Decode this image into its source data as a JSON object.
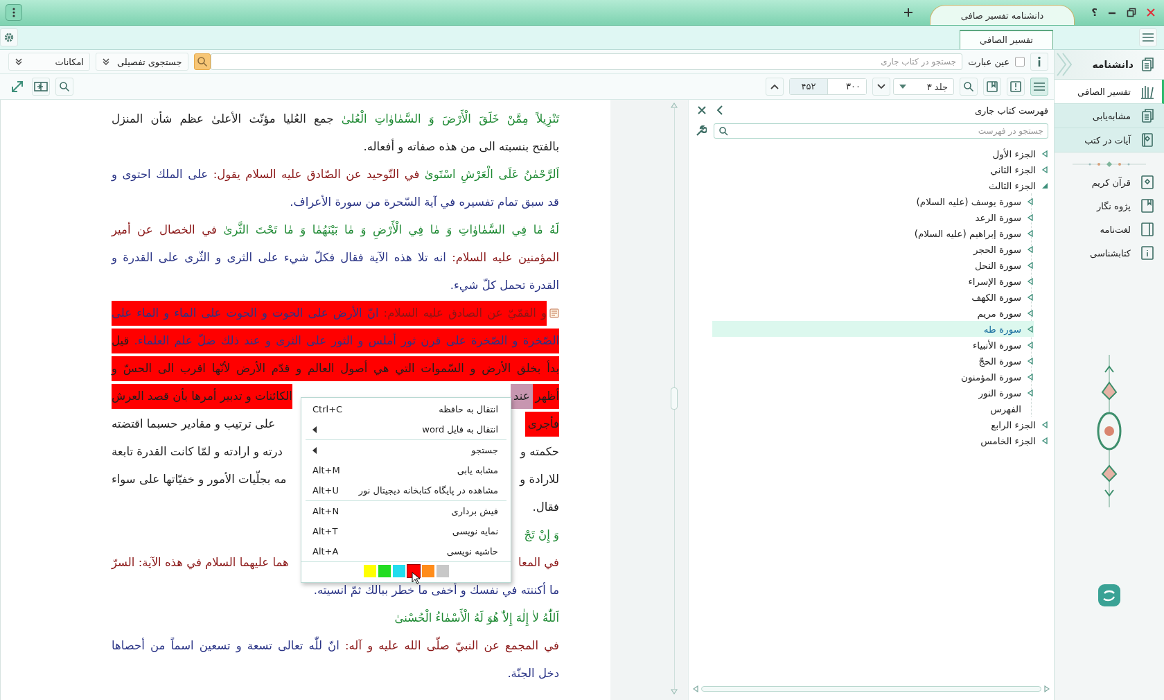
{
  "title_bar": {
    "tab_title": "دانشنامه تفسیر صافی",
    "help": "؟"
  },
  "document_tabs": [
    {
      "label": "تفسير الصافي",
      "selected": true
    }
  ],
  "search_bar": {
    "placeholder": "جستجو در کتاب جاری",
    "exact_phrase": {
      "label": "عین عبارت",
      "checked": false
    },
    "advanced_search": "جستجوی تفصیلی",
    "options": "امکانات"
  },
  "view_buttons": [
    {
      "kind": "list",
      "selected": true
    },
    {
      "kind": "book-alert",
      "selected": false
    },
    {
      "kind": "book",
      "selected": false
    },
    {
      "kind": "search",
      "selected": false
    }
  ],
  "page_nav": {
    "volume": "جلد ۳",
    "field_1": "۳۰۰",
    "field_2": "۴۵۲"
  },
  "text": {
    "lines": [
      {
        "last": false,
        "has_note": false,
        "fragments": [
          {
            "kind": "full",
            "highlighted": false,
            "selected": false,
            "runs": [
              {
                "kind": "quran",
                "text": "تَنْزِيلاً مِمَّنْ خَلَقَ الْأَرْضَ وَ السَّمٰاوٰاتِ الْعُلىٰ"
              },
              {
                "kind": "plain",
                "text": " جمع العُليا مؤنّث الأعلىٰ عظم شأن المنزل"
              }
            ]
          }
        ]
      },
      {
        "last": true,
        "has_note": false,
        "fragments": [
          {
            "kind": "full",
            "highlighted": false,
            "selected": false,
            "runs": [
              {
                "kind": "plain",
                "text": "بالفتح بنسبته الى من هذه صفاته و أفعاله."
              }
            ]
          }
        ]
      },
      {
        "last": false,
        "has_note": false,
        "fragments": [
          {
            "kind": "full",
            "highlighted": false,
            "selected": false,
            "runs": [
              {
                "kind": "quran",
                "text": "اَلرَّحْمٰنُ عَلَى الْعَرْشِ اسْتَوىٰ"
              },
              {
                "kind": "source",
                "text": " في التّوحيد عن الصّادق عليه السلام يقول:"
              },
              {
                "kind": "hadith",
                "text": " على الملك احتوى و"
              }
            ]
          }
        ]
      },
      {
        "last": true,
        "has_note": false,
        "fragments": [
          {
            "kind": "full",
            "highlighted": false,
            "selected": false,
            "runs": [
              {
                "kind": "hadith",
                "text": "قد سبق تمام تفسيره في آية السّحرة من سورة الأعراف."
              }
            ]
          }
        ]
      },
      {
        "last": false,
        "has_note": false,
        "fragments": [
          {
            "kind": "full",
            "highlighted": false,
            "selected": false,
            "runs": [
              {
                "kind": "quran",
                "text": "لَهُ مٰا فِي السَّمٰاوٰاتِ وَ مٰا فِي الْأَرْضِ وَ مٰا بَيْنَهُمٰا وَ مٰا تَحْتَ الثَّرىٰ"
              },
              {
                "kind": "source",
                "text": " في الخصال عن أمير"
              }
            ]
          }
        ]
      },
      {
        "last": false,
        "has_note": false,
        "fragments": [
          {
            "kind": "full",
            "highlighted": false,
            "selected": false,
            "runs": [
              {
                "kind": "source",
                "text": "المؤمنين عليه السلام:"
              },
              {
                "kind": "hadith",
                "text": " انه تلا هذه الآية فقال فكلّ شيء على الثرى و الثّرى على القدرة و"
              }
            ]
          }
        ]
      },
      {
        "last": true,
        "has_note": false,
        "fragments": [
          {
            "kind": "full",
            "highlighted": false,
            "selected": false,
            "runs": [
              {
                "kind": "hadith",
                "text": "القدرة تحمل كلّ شيء."
              }
            ]
          }
        ]
      },
      {
        "last": false,
        "has_note": true,
        "fragments": [
          {
            "kind": "full",
            "highlighted": true,
            "color": "#ff0000",
            "selected": false,
            "runs": [
              {
                "kind": "source",
                "text": "و القمّيّ عن الصادق عليه السلام:"
              },
              {
                "kind": "hadith",
                "text": " انّ الأرض على الحوت و الحوت على الماء و الماء على"
              }
            ]
          }
        ]
      },
      {
        "last": false,
        "has_note": false,
        "fragments": [
          {
            "kind": "full",
            "highlighted": true,
            "color": "#ff0000",
            "selected": false,
            "runs": [
              {
                "kind": "hadith",
                "text": "الصّخرة و الصّخرة على قرن ثور أملس و الثور على الثرى و عند ذلك ضلّ علم العلماء."
              },
              {
                "kind": "plain",
                "text": " قيل"
              }
            ]
          }
        ]
      },
      {
        "last": false,
        "has_note": false,
        "fragments": [
          {
            "kind": "full",
            "highlighted": true,
            "color": "#ff0000",
            "selected": false,
            "runs": [
              {
                "kind": "plain",
                "text": "بدأ بخلق الأرض و السّموات التي هي أصول العالم و قدّم الأرض لأنّها اقرب الى الحسّ و"
              }
            ]
          }
        ]
      },
      {
        "has_note": false,
        "fragments": [
          {
            "kind": "right",
            "highlighted": true,
            "color": "#ff0000",
            "selected": false,
            "runs": [
              {
                "kind": "plain",
                "text": "أظهر"
              }
            ]
          },
          {
            "kind": "right",
            "highlighted": true,
            "color": "#c796b0",
            "selected": true,
            "runs": [
              {
                "kind": "plain",
                "text": "عند"
              }
            ]
          },
          {
            "kind": "left",
            "highlighted": true,
            "color": "#ff0000",
            "selected": false,
            "runs": [
              {
                "kind": "plain",
                "text": "الكائنات و تدبير أمرها بأن قصد العرش"
              }
            ]
          }
        ]
      },
      {
        "has_note": false,
        "fragments": [
          {
            "kind": "right",
            "highlighted": true,
            "color": "#ff0000",
            "selected": false,
            "runs": [
              {
                "kind": "plain",
                "text": "فأجرى"
              }
            ]
          },
          {
            "kind": "left",
            "highlighted": false,
            "selected": false,
            "runs": [
              {
                "kind": "plain",
                "text": "على ترتيب و مقادير حسبما اقتضته"
              }
            ]
          }
        ]
      },
      {
        "has_note": false,
        "fragments": [
          {
            "kind": "right",
            "highlighted": false,
            "selected": false,
            "runs": [
              {
                "kind": "plain",
                "text": "حكمته و"
              }
            ]
          },
          {
            "kind": "left",
            "highlighted": false,
            "selected": false,
            "runs": [
              {
                "kind": "plain",
                "text": "درته و ارادته و لمّا كانت القدرة تابعة"
              }
            ]
          }
        ]
      },
      {
        "has_note": false,
        "fragments": [
          {
            "kind": "right",
            "highlighted": false,
            "selected": false,
            "runs": [
              {
                "kind": "plain",
                "text": "للارادة و"
              }
            ]
          },
          {
            "kind": "left",
            "highlighted": false,
            "selected": false,
            "runs": [
              {
                "kind": "plain",
                "text": "مه بجلّيات الأمور و خفيّاتها على سواء"
              }
            ]
          }
        ]
      },
      {
        "last": true,
        "has_note": false,
        "fragments": [
          {
            "kind": "full",
            "highlighted": false,
            "selected": false,
            "runs": [
              {
                "kind": "plain",
                "text": "فقال."
              }
            ]
          }
        ]
      },
      {
        "has_note": false,
        "fragments": [
          {
            "kind": "right",
            "highlighted": false,
            "selected": false,
            "runs": [
              {
                "kind": "quran",
                "text": "وَ إِنْ تَجْ"
              }
            ]
          }
        ]
      },
      {
        "has_note": false,
        "fragments": [
          {
            "kind": "right",
            "highlighted": false,
            "selected": false,
            "runs": [
              {
                "kind": "source",
                "text": "في المعا"
              }
            ]
          },
          {
            "kind": "left",
            "highlighted": false,
            "selected": false,
            "runs": [
              {
                "kind": "source",
                "text": "هما عليهما السلام في هذه الآية: السرّ"
              }
            ]
          }
        ]
      },
      {
        "last": true,
        "has_note": false,
        "fragments": [
          {
            "kind": "full",
            "highlighted": false,
            "selected": false,
            "runs": [
              {
                "kind": "hadith",
                "text": "ما أكننته في نفسك و أخفى ما خطر ببالك ثمّ انسيته."
              }
            ]
          }
        ]
      },
      {
        "last": true,
        "has_note": false,
        "fragments": [
          {
            "kind": "full",
            "highlighted": false,
            "selected": false,
            "runs": [
              {
                "kind": "quran",
                "text": "اَللّٰهُ لاٰ إِلٰهَ إِلاّٰ هُوَ لَهُ الْأَسْمٰاءُ الْحُسْنىٰ"
              }
            ]
          }
        ]
      },
      {
        "last": false,
        "has_note": false,
        "fragments": [
          {
            "kind": "full",
            "highlighted": false,
            "selected": false,
            "runs": [
              {
                "kind": "source",
                "text": "في المجمع عن النبيّ صلّى الله عليه و آله:"
              },
              {
                "kind": "hadith",
                "text": " انّ للّٰه تعالى تسعة و تسعين اسماً من أحصاها"
              }
            ]
          }
        ]
      },
      {
        "last": true,
        "has_note": false,
        "fragments": [
          {
            "kind": "full",
            "highlighted": false,
            "selected": false,
            "runs": [
              {
                "kind": "hadith",
                "text": "دخل الجنّة."
              }
            ]
          }
        ]
      }
    ]
  },
  "context_menu": {
    "items": [
      {
        "kind": "item",
        "label": "انتقال به حافظه",
        "shortcut": "Ctrl+C"
      },
      {
        "kind": "submenu",
        "label": "انتقال به فایل word"
      },
      {
        "kind": "separator"
      },
      {
        "kind": "submenu",
        "label": "جستجو"
      },
      {
        "kind": "item",
        "label": "مشابه یابی",
        "shortcut": "Alt+M"
      },
      {
        "kind": "item",
        "label": "مشاهده در پایگاه کتابخانه دیجیتال نور",
        "shortcut": "Alt+U"
      },
      {
        "kind": "separator"
      },
      {
        "kind": "item",
        "label": "فیش برداری",
        "shortcut": "Alt+N"
      },
      {
        "kind": "item",
        "label": "نمایه نویسی",
        "shortcut": "Alt+T"
      },
      {
        "kind": "item",
        "label": "حاشیه نویسی",
        "shortcut": "Alt+A"
      }
    ],
    "swatches": [
      {
        "color": "#ffff00",
        "selected": false
      },
      {
        "color": "#22dd22",
        "selected": false
      },
      {
        "color": "#22ddee",
        "selected": false
      },
      {
        "color": "#ff0000",
        "selected": true
      },
      {
        "color": "#ff8c1a",
        "selected": false
      },
      {
        "color": "#c8c8c8",
        "selected": false
      }
    ]
  },
  "toc": {
    "title": "فهرست کتاب جاری",
    "search_placeholder": "جستجو در فهرست",
    "items": [
      {
        "label": "الجزء الأول",
        "kind": "folder",
        "expanded": false,
        "selected": false
      },
      {
        "label": "الجزء الثاني",
        "kind": "folder",
        "expanded": false,
        "selected": false
      },
      {
        "label": "الجزء الثالث",
        "kind": "folder",
        "expanded": true,
        "selected": false,
        "children": [
          {
            "label": "سورة يوسف (عليه السلام)",
            "kind": "folder",
            "expanded": false,
            "selected": false
          },
          {
            "label": "سورة الرعد",
            "kind": "folder",
            "expanded": false,
            "selected": false
          },
          {
            "label": "سورة إبراهيم (عليه السلام)",
            "kind": "folder",
            "expanded": false,
            "selected": false
          },
          {
            "label": "سورة الحجر",
            "kind": "folder",
            "expanded": false,
            "selected": false
          },
          {
            "label": "سورة النحل",
            "kind": "folder",
            "expanded": false,
            "selected": false
          },
          {
            "label": "سورة الإسراء",
            "kind": "folder",
            "expanded": false,
            "selected": false
          },
          {
            "label": "سورة الكهف",
            "kind": "folder",
            "expanded": false,
            "selected": false
          },
          {
            "label": "سورة مريم",
            "kind": "folder",
            "expanded": false,
            "selected": false
          },
          {
            "label": "سورة طه",
            "kind": "folder",
            "expanded": false,
            "selected": true
          },
          {
            "label": "سورة الأنبياء",
            "kind": "folder",
            "expanded": false,
            "selected": false
          },
          {
            "label": "سورة الحجّ",
            "kind": "folder",
            "expanded": false,
            "selected": false
          },
          {
            "label": "سورة المؤمنون",
            "kind": "folder",
            "expanded": false,
            "selected": false
          },
          {
            "label": "سورة النور",
            "kind": "folder",
            "expanded": false,
            "selected": false
          },
          {
            "label": "الفهرس",
            "kind": "leaf",
            "selected": false
          }
        ]
      },
      {
        "label": "الجزء الرابع",
        "kind": "folder",
        "expanded": false,
        "selected": false
      },
      {
        "label": "الجزء الخامس",
        "kind": "folder",
        "expanded": false,
        "selected": false
      }
    ]
  },
  "sidebar": {
    "title": "دانشنامه",
    "books": [
      {
        "label": "تفسير الصافي",
        "kind": "books",
        "selected": true
      },
      {
        "label": "مشابه‌یابی",
        "kind": "copy",
        "selected": false
      },
      {
        "label": "آیات در کتب",
        "kind": "verses",
        "selected": false
      }
    ],
    "tools": [
      {
        "label": "قرآن کریم",
        "kind": "quran"
      },
      {
        "label": "پژوه نگار",
        "kind": "bookmark"
      },
      {
        "label": "لغت‌نامه",
        "kind": "dictionary"
      },
      {
        "label": "کتابشناسی",
        "kind": "info"
      }
    ]
  }
}
